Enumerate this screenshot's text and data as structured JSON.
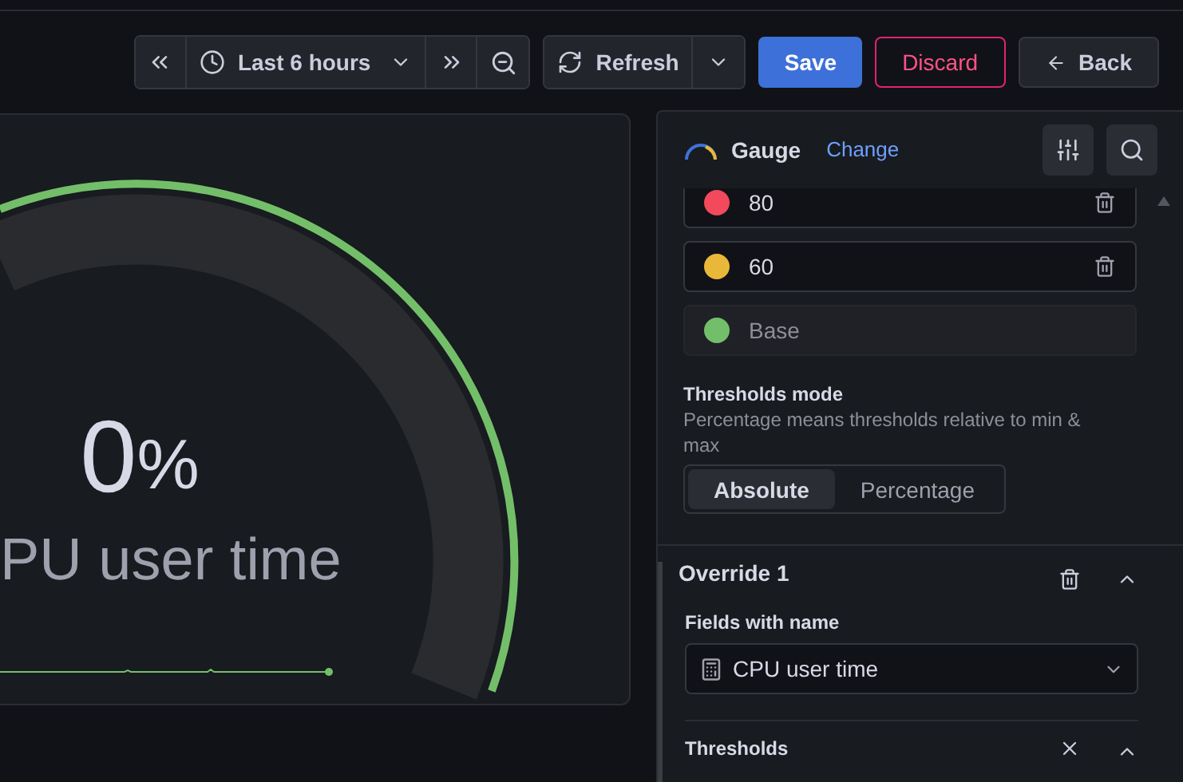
{
  "toolbar": {
    "time_range": "Last 6 hours",
    "refresh": "Refresh",
    "save": "Save",
    "discard": "Discard",
    "back": "Back"
  },
  "panel": {
    "value": "0",
    "unit": "%",
    "label": "PU user time"
  },
  "options": {
    "visualization": "Gauge",
    "change": "Change",
    "thresholds": [
      {
        "kind": "value",
        "value": "80",
        "color": "#f2495c"
      },
      {
        "kind": "value",
        "value": "60",
        "color": "#eab839"
      },
      {
        "kind": "base",
        "value": "Base",
        "color": "#73bf69"
      }
    ],
    "thresholds_mode": {
      "label": "Thresholds mode",
      "description": "Percentage means thresholds relative to min & max",
      "options": [
        {
          "label": "Absolute",
          "selected": true
        },
        {
          "label": "Percentage",
          "selected": false
        }
      ]
    },
    "override": {
      "title": "Override 1",
      "matcher_label": "Fields with name",
      "matcher_value": "CPU user time",
      "property": "Thresholds"
    }
  }
}
